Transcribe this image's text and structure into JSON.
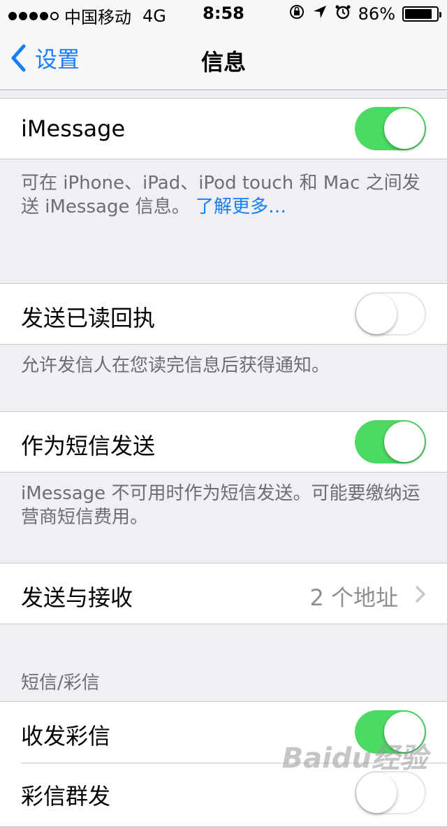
{
  "status_bar": {
    "carrier": "中国移动",
    "network": "4G",
    "time": "8:58",
    "battery": "86%",
    "battery_level": 0.86,
    "signal_bars": 4
  },
  "nav": {
    "back_label": "设置",
    "title": "信息"
  },
  "imessage": {
    "label": "iMessage",
    "on": true,
    "footer_text": "可在 iPhone、iPad、iPod touch 和 Mac 之间发送 iMessage 信息。",
    "footer_link": "了解更多…"
  },
  "read_receipts": {
    "label": "发送已读回执",
    "on": false,
    "footer": "允许发信人在您读完信息后获得通知。"
  },
  "send_as_sms": {
    "label": "作为短信发送",
    "on": true,
    "footer": "iMessage 不可用时作为短信发送。可能要缴纳运营商短信费用。"
  },
  "send_receive": {
    "label": "发送与接收",
    "detail": "2 个地址"
  },
  "sms_mms": {
    "header": "短信/彩信",
    "mms_label": "收发彩信",
    "mms_on": true,
    "group_label": "彩信群发",
    "group_on": false
  },
  "watermark": "Baidu经验",
  "colors": {
    "accent": "#157efb",
    "toggle_on": "#4cd964",
    "background": "#efeff4"
  }
}
